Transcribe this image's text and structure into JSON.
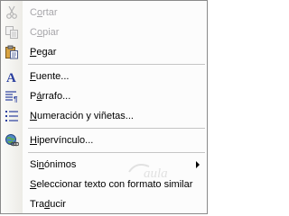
{
  "menu": {
    "items": [
      {
        "pre": "C",
        "accel": "o",
        "post": "rtar",
        "icon": "scissors-icon",
        "enabled": false
      },
      {
        "pre": "C",
        "accel": "o",
        "post": "piar",
        "icon": "copy-icon",
        "enabled": false
      },
      {
        "pre": "",
        "accel": "P",
        "post": "egar",
        "icon": "paste-icon",
        "enabled": true
      },
      {
        "pre": "",
        "accel": "F",
        "post": "uente...",
        "icon": "font-icon",
        "enabled": true
      },
      {
        "pre": "P",
        "accel": "á",
        "post": "rrafo...",
        "icon": "paragraph-icon",
        "enabled": true
      },
      {
        "pre": "",
        "accel": "N",
        "post": "umeración y viñetas...",
        "icon": "bullet-list-icon",
        "enabled": true
      },
      {
        "pre": "",
        "accel": "H",
        "post": "ipervínculo...",
        "icon": "hyperlink-icon",
        "enabled": true
      },
      {
        "pre": "Si",
        "accel": "n",
        "post": "ónimos",
        "icon": "",
        "enabled": true,
        "submenu": true
      },
      {
        "pre": "",
        "accel": "S",
        "post": "eleccionar texto con formato similar",
        "icon": "",
        "enabled": true
      },
      {
        "pre": "Tra",
        "accel": "d",
        "post": "ucir",
        "icon": "",
        "enabled": true
      }
    ]
  },
  "watermark": {
    "text": "aula",
    "color": "#b0b0b0"
  },
  "colors": {
    "disabled_text": "#a7a6aa",
    "font_icon_blue": "#2a3f9e",
    "paste_yellow": "#d9a441"
  }
}
